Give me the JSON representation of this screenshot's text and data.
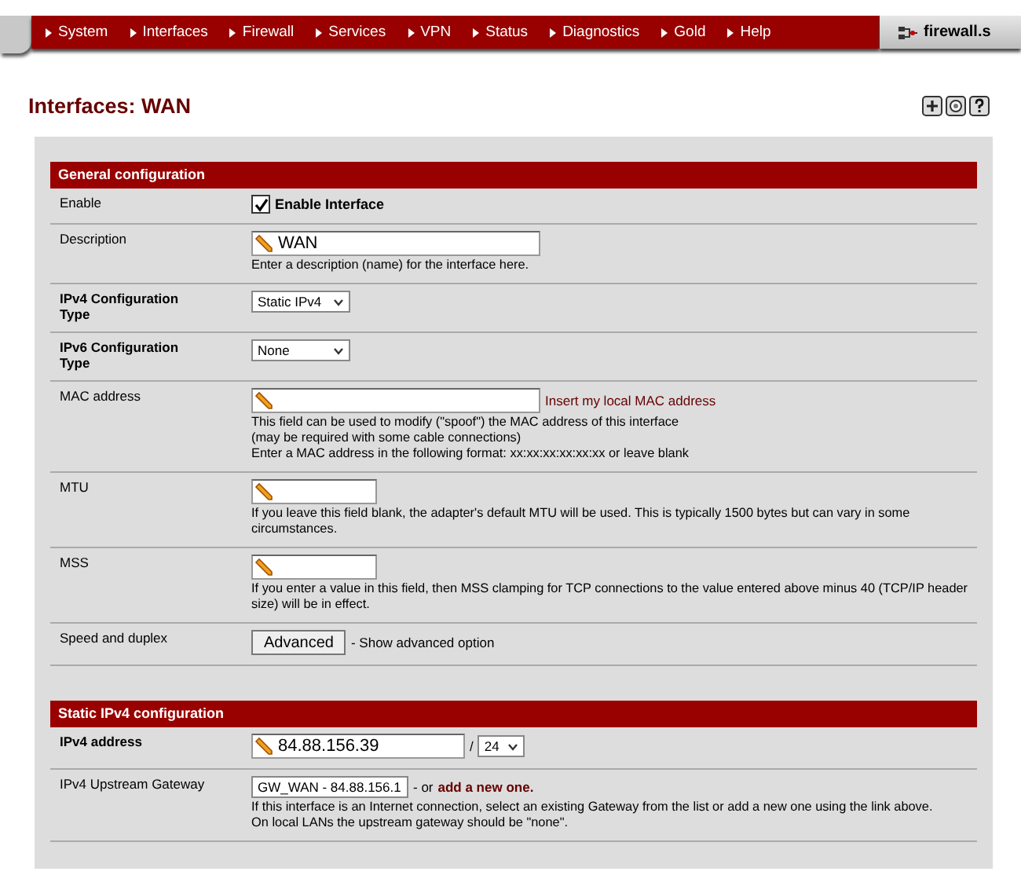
{
  "nav": {
    "items": [
      {
        "label": "System"
      },
      {
        "label": "Interfaces"
      },
      {
        "label": "Firewall"
      },
      {
        "label": "Services"
      },
      {
        "label": "VPN"
      },
      {
        "label": "Status"
      },
      {
        "label": "Diagnostics"
      },
      {
        "label": "Gold"
      },
      {
        "label": "Help"
      }
    ],
    "host": "firewall.s"
  },
  "page_title": "Interfaces: WAN",
  "sections": [
    {
      "title": "General configuration",
      "rows": [
        {
          "kind": "checkbox",
          "label": "Enable",
          "label_bold": false,
          "checked": true,
          "text": "Enable Interface"
        },
        {
          "kind": "text",
          "label": "Description",
          "label_bold": false,
          "value": "WAN",
          "hint": [
            "Enter a description (name) for the interface here."
          ]
        },
        {
          "kind": "select",
          "label": "IPv4 Configuration Type",
          "label_bold": true,
          "value": "Static IPv4"
        },
        {
          "kind": "select",
          "label": "IPv6 Configuration Type",
          "label_bold": true,
          "value": "None"
        },
        {
          "kind": "text",
          "label": "MAC address",
          "label_bold": false,
          "link": "Insert my local MAC address",
          "hint": [
            "This field can be used to modify (\"spoof\") the MAC address of this interface",
            "(may be required with some cable connections)",
            "Enter a MAC address in the following format: xx:xx:xx:xx:xx:xx or leave blank"
          ]
        },
        {
          "kind": "number",
          "label": "MTU",
          "label_bold": false,
          "hint": [
            "If you leave this field blank, the adapter's default MTU will be used. This is typically 1500 bytes but can vary in some circumstances."
          ]
        },
        {
          "kind": "number",
          "label": "MSS",
          "label_bold": false,
          "hint": [
            "If you enter a value in this field, then MSS clamping for TCP connections to the value entered above minus 40 (TCP/IP header size) will be in effect."
          ]
        },
        {
          "kind": "button",
          "label": "Speed and duplex",
          "label_bold": false,
          "button": "Advanced",
          "note": "- Show advanced option"
        }
      ]
    },
    {
      "title": "Static IPv4 configuration",
      "rows": [
        {
          "kind": "ip",
          "label": "IPv4 address",
          "label_bold": true,
          "value": "84.88.156.39",
          "slash": "/",
          "mask": "24"
        },
        {
          "kind": "gateway",
          "label": "IPv4 Upstream Gateway",
          "label_bold": false,
          "value": "GW_WAN - 84.88.156.1",
          "note": "- or",
          "link": "add a new one.",
          "hint": [
            "If this interface is an Internet connection, select an existing Gateway from the list or add a new one using the link above.",
            "On local LANs the upstream gateway should be \"none\"."
          ]
        }
      ]
    }
  ]
}
